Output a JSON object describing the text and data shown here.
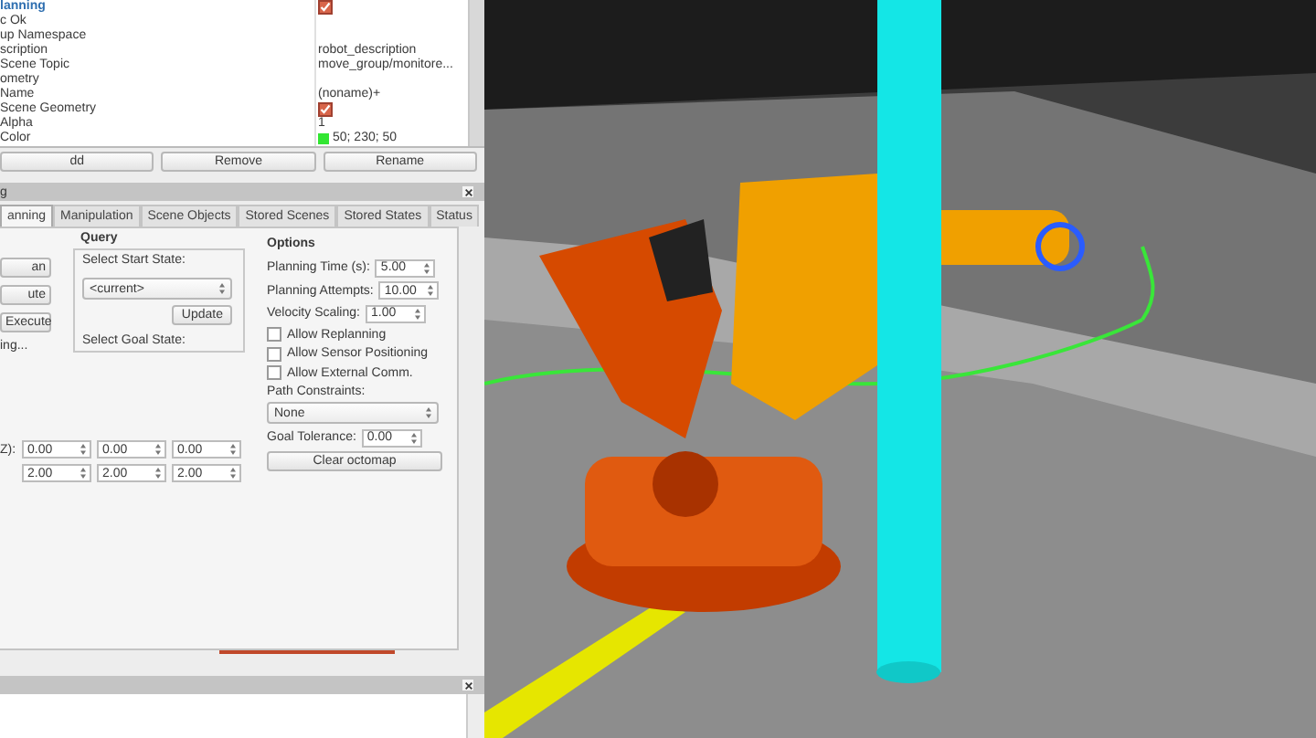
{
  "properties": [
    {
      "name": "lanning",
      "kind": "group",
      "value": {
        "kind": "checkbox",
        "checked": true
      }
    },
    {
      "name": "c Ok",
      "kind": "plain"
    },
    {
      "name": "up Namespace",
      "kind": "plain"
    },
    {
      "name": "scription",
      "kind": "plain",
      "value": {
        "kind": "text",
        "text": "robot_description"
      }
    },
    {
      "name": "Scene Topic",
      "kind": "plain",
      "value": {
        "kind": "text",
        "text": "move_group/monitore..."
      }
    },
    {
      "name": "ometry",
      "kind": "plain"
    },
    {
      "name": "Name",
      "kind": "plain",
      "value": {
        "kind": "text",
        "text": "(noname)+"
      }
    },
    {
      "name": "Scene Geometry",
      "kind": "plain",
      "value": {
        "kind": "checkbox",
        "checked": true
      }
    },
    {
      "name": "Alpha",
      "kind": "plain",
      "value": {
        "kind": "text",
        "text": "1"
      }
    },
    {
      "name": "Color",
      "kind": "plain",
      "value": {
        "kind": "color",
        "text": "50; 230; 50",
        "color": "#32e632"
      }
    }
  ],
  "display_buttons": [
    "dd",
    "Remove",
    "Rename"
  ],
  "panel": {
    "title": "g",
    "tabs": [
      {
        "label": "anning",
        "selected": true
      },
      {
        "label": "Manipulation",
        "selected": false
      },
      {
        "label": "Scene Objects",
        "selected": false
      },
      {
        "label": "Stored Scenes",
        "selected": false
      },
      {
        "label": "Stored States",
        "selected": false
      },
      {
        "label": "Status",
        "selected": false
      }
    ],
    "command_buttons": [
      "an",
      "ute",
      "Execute"
    ],
    "command_status": "ing...",
    "query": {
      "heading": "Query",
      "start_label": "Select Start State:",
      "start_value": "<current>",
      "update_button": "Update",
      "goal_label": "Select Goal State:"
    },
    "workspace": {
      "label": "Z):",
      "rows": [
        [
          "0.00",
          "0.00",
          "0.00"
        ],
        [
          "2.00",
          "2.00",
          "2.00"
        ]
      ]
    },
    "options": {
      "heading": "Options",
      "spin_fields": [
        {
          "label": "Planning Time (s):",
          "value": "5.00"
        },
        {
          "label": "Planning Attempts:",
          "value": "10.00"
        },
        {
          "label": "Velocity Scaling:",
          "value": "1.00"
        }
      ],
      "checkboxes": [
        {
          "label": "Allow Replanning",
          "checked": false
        },
        {
          "label": "Allow Sensor Positioning",
          "checked": false
        },
        {
          "label": "Allow External Comm.",
          "checked": false
        }
      ],
      "path_label": "Path Constraints:",
      "path_value": "None",
      "tolerance": {
        "label": "Goal Tolerance:",
        "value": "0.00"
      },
      "clear_button": "Clear octomap"
    }
  }
}
